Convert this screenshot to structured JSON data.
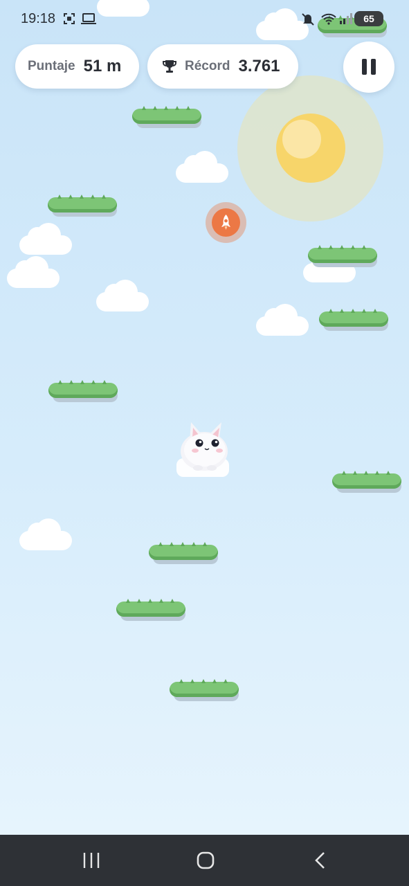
{
  "status_bar": {
    "time": "19:18",
    "battery": "65",
    "icons": [
      "screenshot-icon",
      "laptop-icon",
      "mute-icon",
      "wifi-icon",
      "signal-icon"
    ]
  },
  "hud": {
    "score_label": "Puntaje",
    "score_value": "51 m",
    "record_label": "Récord",
    "record_value": "3.761",
    "record_icon": "trophy-icon",
    "pause_icon": "pause-icon"
  },
  "game": {
    "player": "white-cat",
    "powerup": "rocket-icon",
    "colors": {
      "sky_top": "#c9e4f8",
      "sky_bottom": "#e6f4fd",
      "platform": "#7dc576",
      "sun": "#f7d56a",
      "rocket": "#ec7845"
    }
  },
  "navigation_bar": {
    "buttons": [
      "recent-apps-icon",
      "home-icon",
      "back-icon"
    ]
  }
}
